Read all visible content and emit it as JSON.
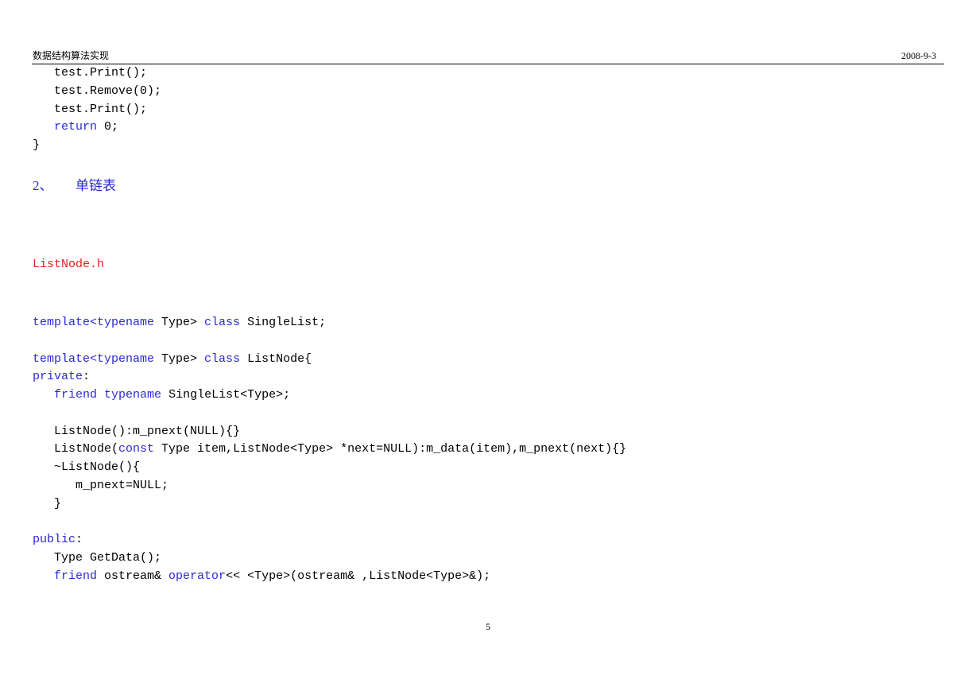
{
  "header": {
    "title": "数据结构算法实现",
    "date": "2008-9-3"
  },
  "colors": {
    "keyword": "#2a2ad4",
    "filename": "#e02020",
    "text": "#000000"
  },
  "code_top": [
    [
      {
        "t": "   test.Print();"
      }
    ],
    [
      {
        "t": "   test.Remove(0);"
      }
    ],
    [
      {
        "t": "   test.Print();"
      }
    ],
    [
      {
        "t": "   "
      },
      {
        "t": "return",
        "k": true
      },
      {
        "t": " 0;"
      }
    ],
    [
      {
        "t": "}"
      }
    ]
  ],
  "section": {
    "number": "2、",
    "title": "单链表"
  },
  "file_name": "ListNode.h",
  "code_main": [
    [
      {
        "t": "template<typename",
        "k": true
      },
      {
        "t": " Type> "
      },
      {
        "t": "class",
        "k": true
      },
      {
        "t": " SingleList;"
      }
    ],
    [
      {
        "t": ""
      }
    ],
    [
      {
        "t": "template<typename",
        "k": true
      },
      {
        "t": " Type> "
      },
      {
        "t": "class",
        "k": true
      },
      {
        "t": " ListNode{"
      }
    ],
    [
      {
        "t": "private",
        "k": true
      },
      {
        "t": ":"
      }
    ],
    [
      {
        "t": "   "
      },
      {
        "t": "friend",
        "k": true
      },
      {
        "t": " "
      },
      {
        "t": "typename",
        "k": true
      },
      {
        "t": " SingleList<Type>;"
      }
    ],
    [
      {
        "t": ""
      }
    ],
    [
      {
        "t": "   ListNode():m_pnext(NULL){}"
      }
    ],
    [
      {
        "t": "   ListNode("
      },
      {
        "t": "const",
        "k": true
      },
      {
        "t": " Type item,ListNode<Type> *next=NULL):m_data(item),m_pnext(next){}"
      }
    ],
    [
      {
        "t": "   ~ListNode(){"
      }
    ],
    [
      {
        "t": "      m_pnext=NULL;"
      }
    ],
    [
      {
        "t": "   }"
      }
    ],
    [
      {
        "t": ""
      }
    ],
    [
      {
        "t": "public",
        "k": true
      },
      {
        "t": ":"
      }
    ],
    [
      {
        "t": "   Type GetData();"
      }
    ],
    [
      {
        "t": "   "
      },
      {
        "t": "friend",
        "k": true
      },
      {
        "t": " ostream& "
      },
      {
        "t": "operator",
        "k": true
      },
      {
        "t": "<< <Type>(ostream& ,ListNode<Type>&);"
      }
    ]
  ],
  "page_number": "5"
}
